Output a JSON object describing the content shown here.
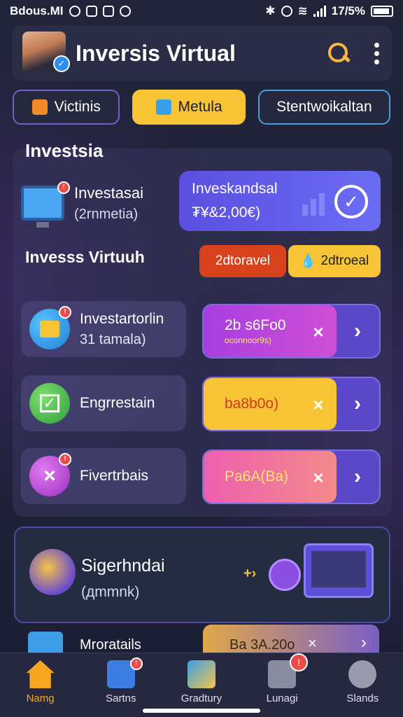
{
  "status_bar": {
    "left_text": "Bdous.MI",
    "battery": "17/5%"
  },
  "header": {
    "title": "Inversis Virtual"
  },
  "tabs": [
    {
      "label": "Victinis"
    },
    {
      "label": "Metula"
    },
    {
      "label": "Stentwoikaltan"
    }
  ],
  "section": {
    "heading": "Investsia"
  },
  "summary": {
    "left_title": "Investasai",
    "left_sub": "(2rnmetia)",
    "card_title": "Inveskandsal",
    "card_value": "₮¥&2,00€)"
  },
  "sub_section": {
    "heading": "Invesss Virtuuh",
    "pill_red": "2dtoravel",
    "pill_yellow": "2dtroeal"
  },
  "rows": [
    {
      "title": "Investartorlin",
      "subtitle": "31 tamala)",
      "value": "2b s6Fo0",
      "value_sub": "oconnoor9s)"
    },
    {
      "title": "Engrrestain",
      "subtitle": "",
      "value": "ba8b0o)",
      "value_sub": ""
    },
    {
      "title": "Fivertrbais",
      "subtitle": "",
      "value": "Pa6A(Ba)",
      "value_sub": ""
    }
  ],
  "promo": {
    "title": "Sigerhndai",
    "subtitle": "(дmmnk)"
  },
  "partial_row": {
    "label": "Mroratails",
    "value": "Ba 3A.20o"
  },
  "bottom_nav": [
    {
      "label": "Namg"
    },
    {
      "label": "Sartns"
    },
    {
      "label": "Gradtury"
    },
    {
      "label": "Lunagi"
    },
    {
      "label": "Slands"
    }
  ],
  "colors": {
    "accent_yellow": "#f7c435",
    "accent_purple": "#5a4fe0",
    "background": "#1e2036"
  }
}
